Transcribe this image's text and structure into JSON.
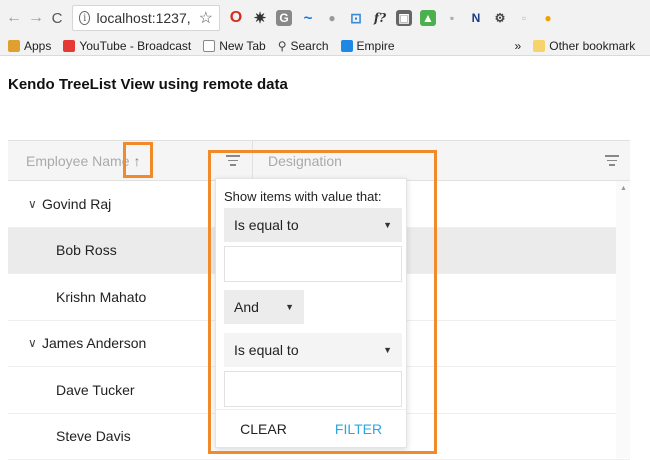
{
  "browser": {
    "url": "localhost:1237,",
    "bookmarks": [
      "Apps",
      "YouTube - Broadcast",
      "New Tab",
      "Search",
      "Empire",
      "»",
      "Other bookmark"
    ]
  },
  "page": {
    "title": "Kendo TreeList View using remote data"
  },
  "treelist": {
    "columns": {
      "employee": "Employee Name",
      "sort_arrow": "↑",
      "designation": "Designation"
    },
    "rows": [
      {
        "name": "Govind Raj",
        "expanded": true,
        "child": false
      },
      {
        "name": "Bob Ross",
        "child": true,
        "selected": true
      },
      {
        "name": "Krishn Mahato",
        "child": true
      },
      {
        "name": "James Anderson",
        "expanded": true,
        "child": false
      },
      {
        "name": "Dave Tucker",
        "child": true
      },
      {
        "name": "Steve Davis",
        "child": true
      }
    ]
  },
  "filter_menu": {
    "prompt": "Show items with value that:",
    "operator1": "Is equal to",
    "logic": "And",
    "operator2": "Is equal to",
    "clear_label": "CLEAR",
    "filter_label": "FILTER"
  },
  "colors": {
    "highlight": "#f08a2a",
    "filter_button": "#2ba7e0"
  }
}
